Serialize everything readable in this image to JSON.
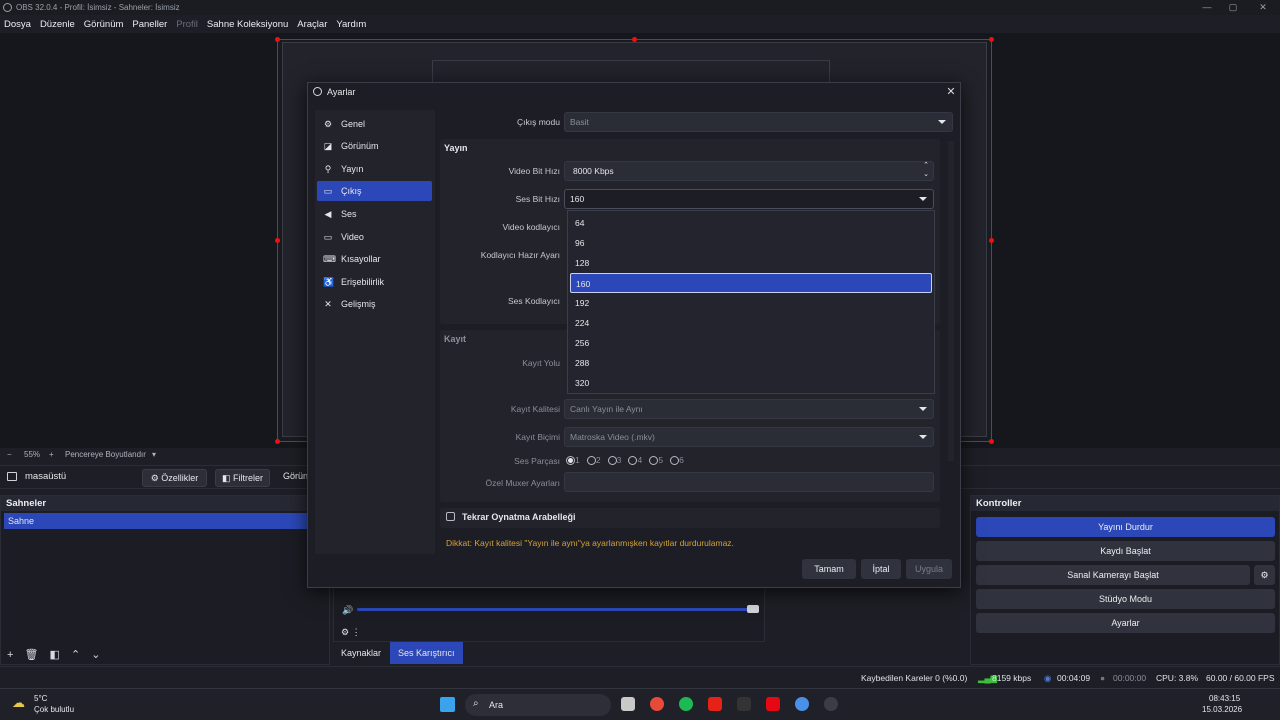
{
  "window": {
    "title": "OBS 32.0.4 - Profil: İsimsiz - Sahneler: İsimsiz"
  },
  "menu": [
    "Dosya",
    "Düzenle",
    "Görünüm",
    "Paneller",
    "Profil",
    "Sahne Koleksiyonu",
    "Araçlar",
    "Yardım"
  ],
  "zoombar": {
    "zoom": "55%",
    "mode": "Pencereye Boyutlandır"
  },
  "source_toolbar": {
    "source_name": "masaüstü",
    "properties": "Özellikler",
    "filters": "Filtreler",
    "more": "Görün"
  },
  "scenes": {
    "title": "Sahneler",
    "items": [
      "Sahne"
    ]
  },
  "controls": {
    "title": "Kontroller",
    "buttons": [
      "Yayını Durdur",
      "Kaydı Başlat",
      "Sanal Kamerayı Başlat",
      "Stüdyo Modu",
      "Ayarlar"
    ]
  },
  "bottom_tabs": [
    "Kaynaklar",
    "Ses Karıştırıcı"
  ],
  "status": {
    "dropped": "Kaybedilen Kareler 0 (%0.0)",
    "bitrate": "8159 kbps",
    "stream_time": "00:04:09",
    "rec_time": "00:00:00",
    "cpu": "CPU: 3.8%",
    "fps": "60.00 / 60.00 FPS"
  },
  "taskbar": {
    "weather_temp": "5°C",
    "weather_desc": "Çok bulutlu",
    "search": "Ara",
    "time": "08:43:15",
    "date": "15.03.2026"
  },
  "dialog": {
    "title": "Ayarlar",
    "sidebar": [
      "Genel",
      "Görünüm",
      "Yayın",
      "Çıkış",
      "Ses",
      "Video",
      "Kısayollar",
      "Erişebilirlik",
      "Gelişmiş"
    ],
    "sidebar_active_index": 3,
    "output_mode_label": "Çıkış modu",
    "output_mode_value": "Basit",
    "stream_section": "Yayın",
    "video_bitrate_label": "Video Bit Hızı",
    "video_bitrate_value": "8000 Kbps",
    "audio_bitrate_label": "Ses Bit Hızı",
    "audio_bitrate_value": "160",
    "video_encoder_label": "Video kodlayıcı",
    "encoder_preset_label": "Kodlayıcı Hazır Ayarı",
    "audio_encoder_label": "Ses Kodlayıcı",
    "dropdown_options": [
      "64",
      "96",
      "128",
      "160",
      "192",
      "224",
      "256",
      "288",
      "320"
    ],
    "dropdown_selected_index": 3,
    "recording_section": "Kayıt",
    "rec_path_label": "Kayıt Yolu",
    "rec_quality_label": "Kayıt Kalitesi",
    "rec_quality_value": "Canlı Yayın ile Aynı",
    "rec_format_label": "Kayıt Biçimi",
    "rec_format_value": "Matroska Video (.mkv)",
    "audio_track_label": "Ses Parçası",
    "audio_tracks": [
      "1",
      "2",
      "3",
      "4",
      "5",
      "6"
    ],
    "muxer_label": "Özel Muxer Ayarları",
    "replay_buffer": "Tekrar Oynatma Arabelleği",
    "warning": "Dikkat: Kayıt kalitesi \"Yayın ile aynı\"ya ayarlanmışken kayıtlar durdurulamaz.",
    "ok": "Tamam",
    "cancel": "İptal",
    "apply": "Uygula"
  }
}
